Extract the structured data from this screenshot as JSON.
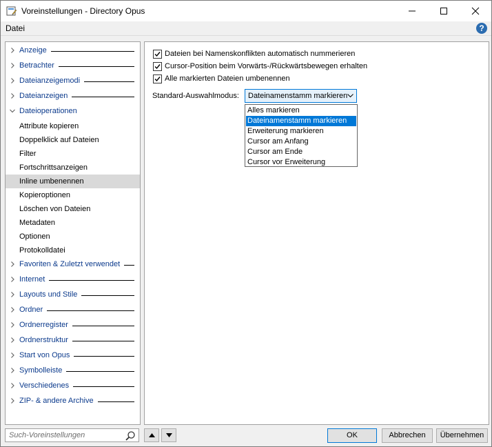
{
  "window": {
    "title": "Voreinstellungen - Directory Opus"
  },
  "menu": {
    "file": "Datei"
  },
  "tree": {
    "items": [
      {
        "label": "Anzeige",
        "type": "category",
        "expanded": false
      },
      {
        "label": "Betrachter",
        "type": "category",
        "expanded": false
      },
      {
        "label": "Dateianzeigemodi",
        "type": "category",
        "expanded": false
      },
      {
        "label": "Dateianzeigen",
        "type": "category",
        "expanded": false
      },
      {
        "label": "Dateioperationen",
        "type": "category",
        "expanded": true
      },
      {
        "label": "Attribute kopieren",
        "type": "child"
      },
      {
        "label": "Doppelklick auf Dateien",
        "type": "child"
      },
      {
        "label": "Filter",
        "type": "child"
      },
      {
        "label": "Fortschrittsanzeigen",
        "type": "child"
      },
      {
        "label": "Inline umbenennen",
        "type": "child",
        "selected": true
      },
      {
        "label": "Kopieroptionen",
        "type": "child"
      },
      {
        "label": "Löschen von Dateien",
        "type": "child"
      },
      {
        "label": "Metadaten",
        "type": "child"
      },
      {
        "label": "Optionen",
        "type": "child"
      },
      {
        "label": "Protokolldatei",
        "type": "child"
      },
      {
        "label": "Favoriten & Zuletzt verwendet",
        "type": "category",
        "expanded": false
      },
      {
        "label": "Internet",
        "type": "category",
        "expanded": false
      },
      {
        "label": "Layouts und Stile",
        "type": "category",
        "expanded": false
      },
      {
        "label": "Ordner",
        "type": "category",
        "expanded": false
      },
      {
        "label": "Ordnerregister",
        "type": "category",
        "expanded": false
      },
      {
        "label": "Ordnerstruktur",
        "type": "category",
        "expanded": false
      },
      {
        "label": "Start von Opus",
        "type": "category",
        "expanded": false
      },
      {
        "label": "Symbolleiste",
        "type": "category",
        "expanded": false
      },
      {
        "label": "Verschiedenes",
        "type": "category",
        "expanded": false
      },
      {
        "label": "ZIP- & andere Archive",
        "type": "category",
        "expanded": false
      }
    ]
  },
  "settings": {
    "checkboxes": [
      {
        "label": "Dateien bei Namenskonflikten automatisch nummerieren",
        "checked": true
      },
      {
        "label": "Cursor-Position beim Vorwärts-/Rückwärtsbewegen erhalten",
        "checked": true
      },
      {
        "label": "Alle markierten Dateien umbenennen",
        "checked": true
      }
    ],
    "selection_mode": {
      "label": "Standard-Auswahlmodus:",
      "value": "Dateinamenstamm markieren",
      "options": [
        "Alles markieren",
        "Dateinamenstamm markieren",
        "Erweiterung markieren",
        "Cursor am Anfang",
        "Cursor am Ende",
        "Cursor vor Erweiterung"
      ],
      "highlighted": "Dateinamenstamm markieren"
    }
  },
  "footer": {
    "search_placeholder": "Such-Voreinstellungen",
    "ok": "OK",
    "cancel": "Abbrechen",
    "apply": "Übernehmen"
  },
  "colors": {
    "category_text": "#0b3a8c",
    "accent": "#0078d7",
    "selected_row": "#d9d9d9"
  }
}
